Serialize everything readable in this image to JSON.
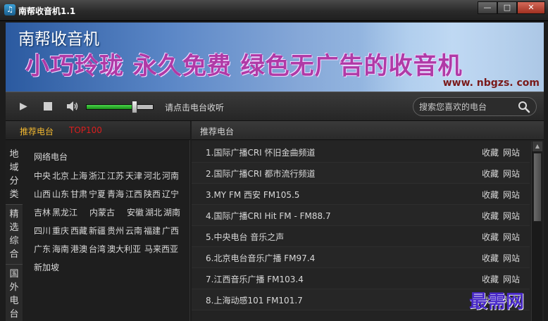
{
  "window": {
    "title": "南帮收音机1.1",
    "app_icon": "music-note-icon",
    "minimize": "—",
    "maximize": "□",
    "close": "✕"
  },
  "banner": {
    "brand": "南帮收音机",
    "slogan": "小巧玲珑  永久免费  绿色无广告的收音机",
    "url": "www. nbgzs. com",
    "colors": {
      "start": "#2b5aa0",
      "end": "#9ec0e6",
      "slogan": "#b03aa6"
    }
  },
  "player": {
    "play_icon": "play-icon",
    "stop_icon": "stop-icon",
    "volume_icon": "speaker-icon",
    "volume_level": 0.72,
    "hint": "请点击电台收听",
    "search": {
      "placeholder": "搜索您喜欢的电台",
      "icon": "search-icon"
    },
    "colors": {
      "volume_fill": "#1a8f1a"
    }
  },
  "left_panel": {
    "tabs": {
      "recommend": "推荐电台",
      "top": "TOP100"
    },
    "colors": {
      "recommend": "#f2b830",
      "top": "#d81e1e"
    },
    "side_tabs": [
      "地域分类",
      "精选综合",
      "国外电台"
    ],
    "region_header": "网络电台",
    "regions": [
      "中央",
      "北京",
      "上海",
      "浙江",
      "江苏",
      "天津",
      "河北",
      "河南",
      "山西",
      "山东",
      "甘肃",
      "宁夏",
      "青海",
      "江西",
      "陕西",
      "辽宁",
      "吉林",
      "黑龙江",
      "内蒙古",
      "安徽",
      "湖北",
      "湖南",
      "四川",
      "重庆",
      "西藏",
      "新疆",
      "贵州",
      "云南",
      "福建",
      "广西",
      "广东",
      "海南",
      "港澳",
      "台湾",
      "澳大利亚",
      "马来西亚",
      "新加坡"
    ]
  },
  "right_panel": {
    "title": "推荐电台",
    "fav_label": "收藏",
    "site_label": "网站",
    "stations": [
      "1.国际广播CRI 怀旧金曲频道",
      "2.国际广播CRI 都市流行频道",
      "3.MY FM 西安 FM105.5",
      "4.国际广播CRI Hit FM - FM88.7",
      "5.中央电台 音乐之声",
      "6.北京电台音乐广播 FM97.4",
      "7.江西音乐广播 FM103.4",
      "8.上海动感101 FM101.7"
    ]
  },
  "watermark": "最需网"
}
